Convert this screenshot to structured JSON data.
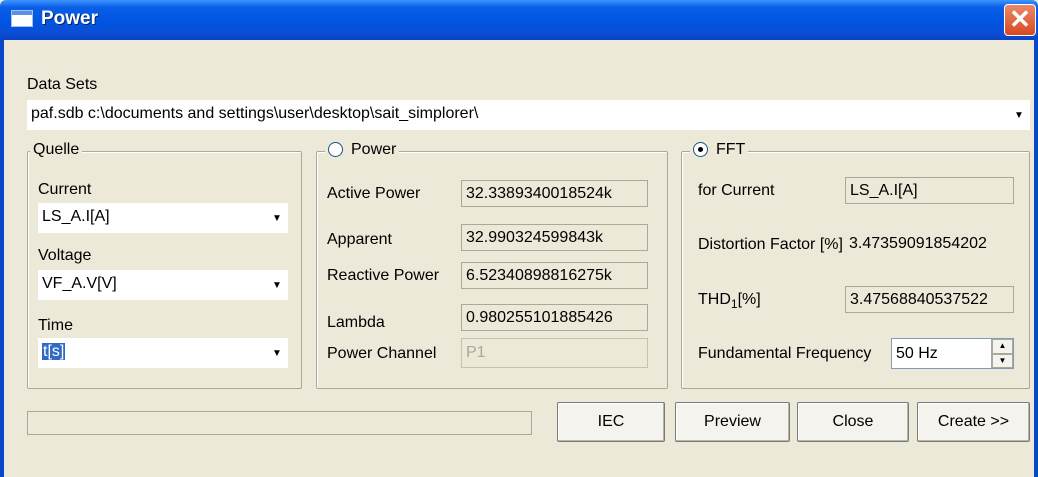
{
  "window": {
    "title": "Power",
    "close_glyph": "✕"
  },
  "data_sets": {
    "label": "Data Sets",
    "value": "paf.sdb c:\\documents and settings\\user\\desktop\\sait_simplorer\\"
  },
  "quelle": {
    "legend": "Quelle",
    "current_label": "Current",
    "current_value": "LS_A.I[A]",
    "voltage_label": "Voltage",
    "voltage_value": "VF_A.V[V]",
    "time_label": "Time",
    "time_value": "t[s]"
  },
  "power": {
    "legend": "Power",
    "selected": false,
    "rows": [
      {
        "label": "Active Power",
        "value": "32.3389340018524k"
      },
      {
        "label": "Apparent",
        "value": "32.990324599843k"
      },
      {
        "label": "Reactive Power",
        "value": "6.52340898816275k"
      },
      {
        "label": "Lambda",
        "value": "0.980255101885426"
      }
    ],
    "channel_label": "Power Channel",
    "channel_value": "P1"
  },
  "fft": {
    "legend": "FFT",
    "selected": true,
    "for_current_label": "for Current",
    "for_current_value": "LS_A.I[A]",
    "distortion_label": "Distortion Factor [%]",
    "distortion_value": "3.47359091854202",
    "thd_label": "THD",
    "thd_sub": "1",
    "thd_suffix": "[%]",
    "thd_value": "3.47568840537522",
    "fund_freq_label": "Fundamental Frequency",
    "fund_freq_value": "50 Hz"
  },
  "buttons": {
    "iec": "IEC",
    "preview": "Preview",
    "close": "Close",
    "create": "Create >>"
  },
  "progress": {
    "fraction": 0
  }
}
